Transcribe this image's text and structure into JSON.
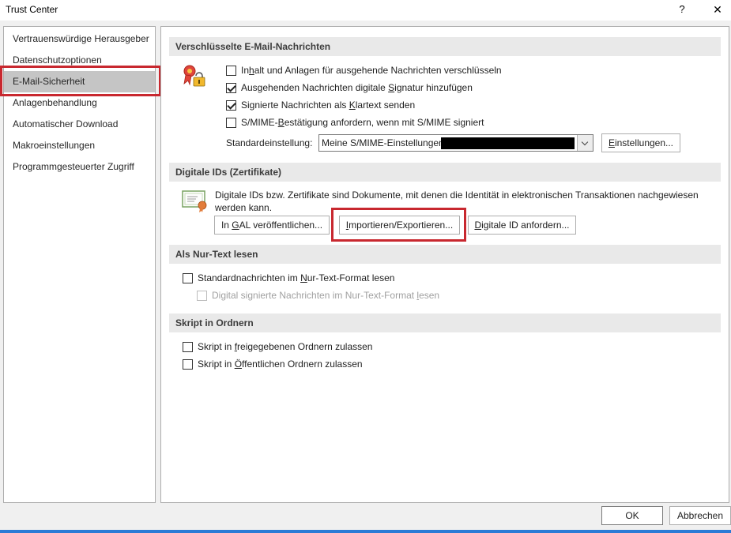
{
  "window": {
    "title": "Trust Center",
    "help_label": "?",
    "close_label": "✕"
  },
  "sidebar": {
    "items": [
      {
        "label": "Vertrauenswürdige Herausgeber",
        "selected": false
      },
      {
        "label": "Datenschutzoptionen",
        "selected": false
      },
      {
        "label": "E-Mail-Sicherheit",
        "selected": true
      },
      {
        "label": "Anlagenbehandlung",
        "selected": false
      },
      {
        "label": "Automatischer Download",
        "selected": false
      },
      {
        "label": "Makroeinstellungen",
        "selected": false
      },
      {
        "label": "Programmgesteuerter Zugriff",
        "selected": false
      }
    ]
  },
  "encrypted": {
    "header": "Verschlüsselte E-Mail-Nachrichten",
    "icon": "certificate-lock-icon",
    "options": [
      {
        "pre": "In",
        "ul": "h",
        "post": "alt und Anlagen für ausgehende Nachrichten verschlüsseln",
        "checked": false
      },
      {
        "pre": "Ausgehenden Nachrichten digitale ",
        "ul": "S",
        "post": "ignatur hinzufügen",
        "checked": true
      },
      {
        "pre": "Signierte Nachrichten als ",
        "ul": "K",
        "post": "lartext senden",
        "checked": true
      },
      {
        "pre": "S/MIME-",
        "ul": "B",
        "post": "estätigung anfordern, wenn mit S/MIME signiert",
        "checked": false
      }
    ],
    "default_label_pre": "Standardeinstellun",
    "default_label_ul": "g",
    "default_label_post": ":",
    "default_value": "Meine S/MIME-Einstellungen",
    "settings_button_pre": "",
    "settings_button_ul": "E",
    "settings_button_post": "instellungen..."
  },
  "digital_ids": {
    "header": "Digitale IDs (Zertifikate)",
    "icon": "certificate-icon",
    "description_line1": "Digitale IDs bzw. Zertifikate sind Dokumente, mit denen die Identität in elektronischen Transaktionen nachgewiesen",
    "description_line2": "werden kann.",
    "publish_pre": "In ",
    "publish_ul": "G",
    "publish_post": "AL veröffentlichen...",
    "import_pre": "",
    "import_ul": "I",
    "import_post": "mportieren/Exportieren...",
    "request_pre": "",
    "request_ul": "D",
    "request_post": "igitale ID anfordern..."
  },
  "plain_text": {
    "header": "Als Nur-Text lesen",
    "option1_pre": "Standardnachrichten im ",
    "option1_ul": "N",
    "option1_post": "ur-Text-Format lesen",
    "option2_pre": "Digital signierte Nachrichten im Nur-Text-Format ",
    "option2_ul": "l",
    "option2_post": "esen"
  },
  "scripts": {
    "header": "Skript in Ordnern",
    "option1_pre": "Skript in ",
    "option1_ul": "f",
    "option1_post": "reigegebenen Ordnern zulassen",
    "option2_pre": "Skript in ",
    "option2_ul": "Ö",
    "option2_post": "ffentlichen Ordnern zulassen"
  },
  "footer": {
    "ok_label": "OK",
    "cancel_label": "Abbrechen"
  },
  "colors": {
    "highlight": "#c8282f",
    "selected_bg": "#c5c5c5",
    "accent_bar": "#2b7bd6"
  }
}
